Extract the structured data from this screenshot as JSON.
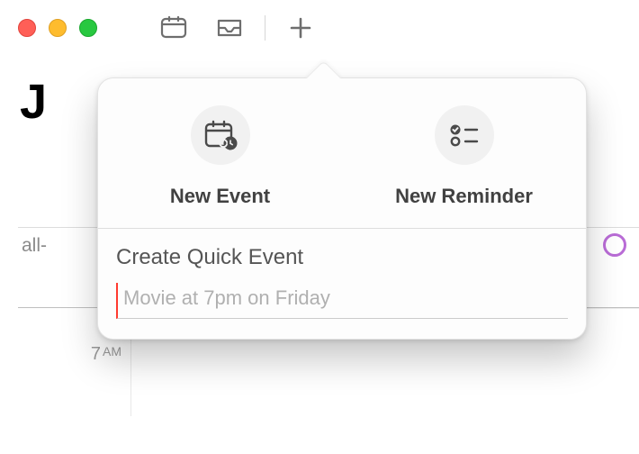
{
  "date_heading": "J",
  "all_day_label": "all-",
  "time_row": {
    "hour": "7",
    "ampm": "AM"
  },
  "popover": {
    "new_event_label": "New Event",
    "new_reminder_label": "New Reminder",
    "quick_title": "Create Quick Event",
    "quick_placeholder": "Movie at 7pm on Friday",
    "quick_value": ""
  },
  "ellipsis_glyph": "…"
}
